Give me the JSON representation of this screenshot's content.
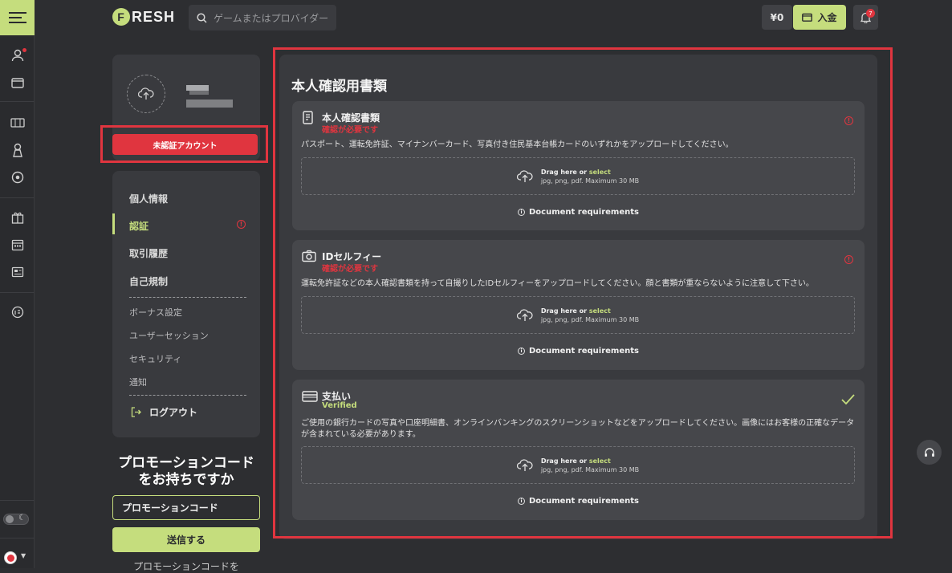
{
  "brand": {
    "logo_letter": "F",
    "logo_rest": "RESH"
  },
  "search": {
    "placeholder": "ゲームまたはプロバイダー"
  },
  "header": {
    "balance": "¥0",
    "deposit_label": "入金",
    "notifications_count": "7"
  },
  "profile": {
    "verification_status": "未認証アカウント"
  },
  "nav": {
    "items": [
      {
        "label": "個人情報"
      },
      {
        "label": "認証",
        "active": true
      },
      {
        "label": "取引履歴"
      },
      {
        "label": "自己規制"
      }
    ],
    "sub_items": [
      {
        "label": "ボーナス設定"
      },
      {
        "label": "ユーザーセッション"
      },
      {
        "label": "セキュリティ"
      },
      {
        "label": "通知"
      }
    ],
    "logout_label": "ログアウト"
  },
  "promo": {
    "title_line1": "プロモーションコード",
    "title_line2": "をお持ちですか",
    "input_value": "プロモーションコード",
    "submit_label": "送信する",
    "footer_text": "プロモーションコードを"
  },
  "main": {
    "title": "本人確認用書類",
    "documents": [
      {
        "name": "本人確認書類",
        "status": "確認が必要です",
        "description": "パスポート、運転免許証、マイナンバーカード、写真付き住民基本台帳カードのいずれかをアップロードしてください。",
        "drop_text": "Drag here or",
        "drop_select": "select",
        "drop_formats": "jpg, png, pdf. Maximum 30 MB",
        "requirements": "Document requirements"
      },
      {
        "name": "IDセルフィー",
        "status": "確認が必要です",
        "description": "運転免許証などの本人確認書類を持って自撮りしたIDセルフィーをアップロードしてください。顔と書類が重ならないように注意して下さい。",
        "drop_text": "Drag here or",
        "drop_select": "select",
        "drop_formats": "jpg, png, pdf. Maximum 30 MB",
        "requirements": "Document requirements"
      },
      {
        "name": "支払い",
        "status": "Verified",
        "description": "ご使用の銀行カードの写真や口座明細書、オンラインバンキングのスクリーンショットなどをアップロードしてください。画像にはお客様の正確なデータが含まれている必要があります。",
        "drop_text": "Drag here or",
        "drop_select": "select",
        "drop_formats": "jpg, png, pdf. Maximum 30 MB",
        "requirements": "Document requirements"
      }
    ]
  },
  "colors": {
    "accent": "#c5dd7d",
    "alert": "#e0353f",
    "background": "#2d2e31",
    "card": "#393a3e"
  }
}
